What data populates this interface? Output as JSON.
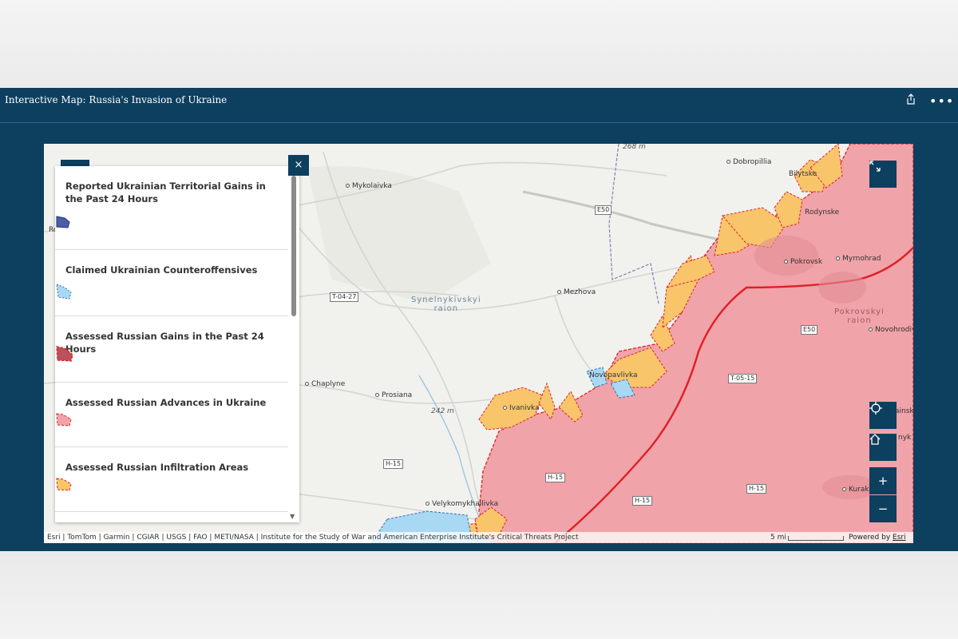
{
  "header": {
    "title": "Interactive Map: Russia's Invasion of Ukraine",
    "share_icon": "share-icon",
    "more_label": "•••"
  },
  "legend": {
    "items": [
      {
        "label": "Reported Ukrainian Territorial Gains in the Past 24 Hours",
        "swatch": "solid-blue-swatch"
      },
      {
        "label": "Claimed Ukrainian Counteroffensives",
        "swatch": "hatched-light-blue-swatch"
      },
      {
        "label": "Assessed Russian Gains in the Past 24 Hours",
        "swatch": "dark-red-swatch"
      },
      {
        "label": "Assessed Russian Advances in Ukraine",
        "swatch": "pink-swatch"
      },
      {
        "label": "Assessed Russian Infiltration Areas",
        "swatch": "orange-swatch"
      }
    ],
    "close_label": "×"
  },
  "map": {
    "places": {
      "dobropillia": "Dobropillia",
      "bilytske": "Bilytske",
      "rodynske": "Rodynske",
      "pokrovsk": "Pokrovsk",
      "myrnohrad": "Myrnohrad",
      "mykolaivka": "Mykolaivka",
      "mezhova": "Mezhova",
      "novopavlivka": "Novopavlivka",
      "chaplyne": "Chaplyne",
      "prosiana": "Prosiana",
      "ivanivka": "Ivanivka",
      "velykomykhailivka": "Velykomykhailivka",
      "novohrodivka": "Novohrodivka",
      "kurakhove_partial": "Kurakho",
      "edge_left": "Ro",
      "edge_right1": "ainsk",
      "edge_right2": "nyk"
    },
    "raions": {
      "synelnykivskyi_line1": "Synelnykivskyi",
      "synelnykivskyi_line2": "raion",
      "pokrovskyi_line1": "Pokrovskyi",
      "pokrovskyi_line2": "raion"
    },
    "elevations": {
      "top": "268 m",
      "mid": "242 m"
    },
    "roads": {
      "e50_west": "E50",
      "e50_east": "E50",
      "t0427": "T-04-27",
      "t0515": "T-05-15",
      "h15_a": "H-15",
      "h15_b": "H-15",
      "h15_c": "H-15",
      "h15_d": "H-15"
    },
    "attribution": "Esri | TomTom | Garmin | CGIAR | USGS | FAO | METI/NASA | Institute for the Study of War and American Enterprise Institute's Critical Threats Project",
    "scale_label": "5 mi",
    "powered_prefix": "Powered by ",
    "powered_link": "Esri",
    "colors": {
      "russian_advances": "#f0a3a8",
      "infiltration": "#f8c56b",
      "ukrainian_counter": "#a8d8f4",
      "frontline": "#e01e26"
    }
  },
  "controls": {
    "expand_icon": "expand-icon",
    "locate_icon": "locate-icon",
    "home_icon": "home-icon",
    "zoom_in_label": "+",
    "zoom_out_label": "−"
  }
}
